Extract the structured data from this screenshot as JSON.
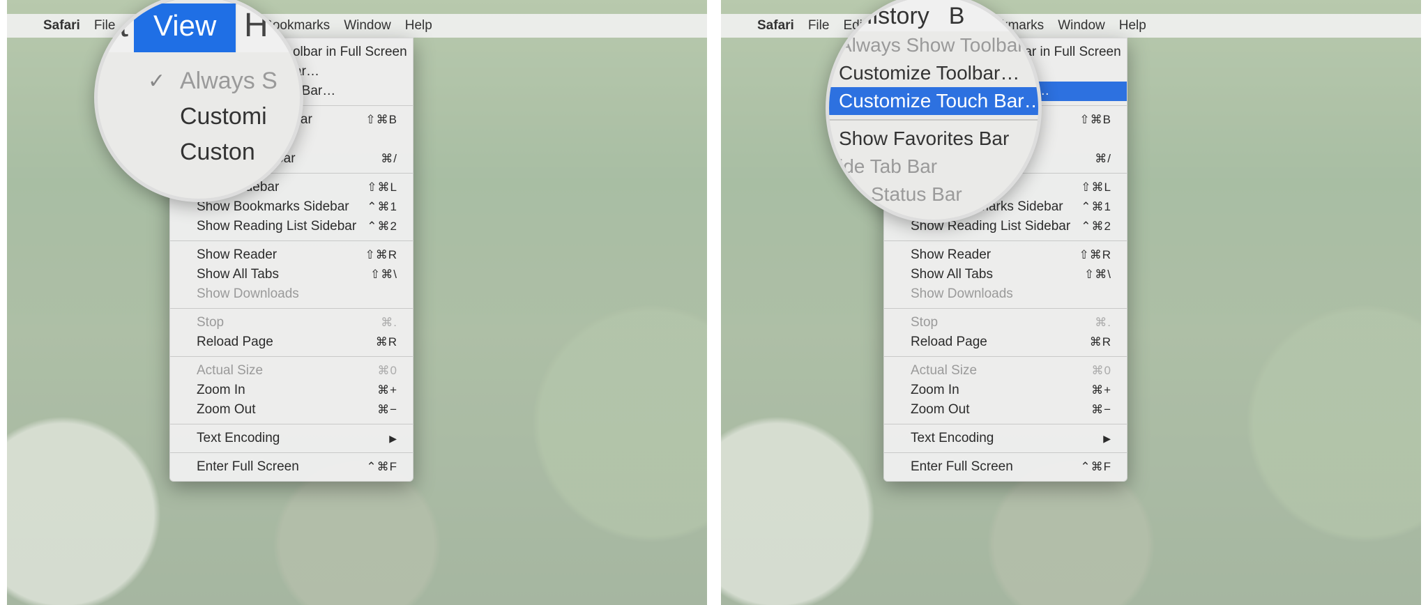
{
  "menubar": {
    "apple": "",
    "app": "Safari",
    "items": [
      "File",
      "Edit",
      "View",
      "History",
      "Bookmarks",
      "Window",
      "Help"
    ]
  },
  "dropdown_left": {
    "items": [
      {
        "label": "Always Show Toolbar in Full Screen",
        "shortcut": "",
        "checked": true
      },
      {
        "label": "Customize Toolbar…",
        "shortcut": ""
      },
      {
        "label": "Customize Touch Bar…",
        "shortcut": ""
      },
      {
        "sep": true
      },
      {
        "label": "Show Favorites Bar",
        "shortcut": "⇧⌘B"
      },
      {
        "label": "Hide Tab Bar",
        "shortcut": ""
      },
      {
        "label": "Show Status Bar",
        "shortcut": "⌘/"
      },
      {
        "sep": true
      },
      {
        "label": "Show Sidebar",
        "shortcut": "⇧⌘L"
      },
      {
        "label": "Show Bookmarks Sidebar",
        "shortcut": "⌃⌘1"
      },
      {
        "label": "Show Reading List Sidebar",
        "shortcut": "⌃⌘2"
      },
      {
        "sep": true
      },
      {
        "label": "Show Reader",
        "shortcut": "⇧⌘R"
      },
      {
        "label": "Show All Tabs",
        "shortcut": "⇧⌘\\"
      },
      {
        "label": "Show Downloads",
        "shortcut": "",
        "disabled": true
      },
      {
        "sep": true
      },
      {
        "label": "Stop",
        "shortcut": "⌘.",
        "disabled": true
      },
      {
        "label": "Reload Page",
        "shortcut": "⌘R"
      },
      {
        "sep": true
      },
      {
        "label": "Actual Size",
        "shortcut": "⌘0",
        "disabled": true
      },
      {
        "label": "Zoom In",
        "shortcut": "⌘+"
      },
      {
        "label": "Zoom Out",
        "shortcut": "⌘−"
      },
      {
        "sep": true
      },
      {
        "label": "Text Encoding",
        "shortcut": "",
        "submenu": true
      },
      {
        "sep": true
      },
      {
        "label": "Enter Full Screen",
        "shortcut": "⌃⌘F"
      }
    ]
  },
  "dropdown_right": {
    "items": [
      {
        "label": "Always Show Toolbar in Full Screen",
        "shortcut": "",
        "checked": true
      },
      {
        "label": "Customize Toolbar…",
        "shortcut": ""
      },
      {
        "label": "Customize Touch Bar…",
        "shortcut": "",
        "highlight": true
      },
      {
        "sep": true
      },
      {
        "label": "Show Favorites Bar",
        "shortcut": "⇧⌘B"
      },
      {
        "label": "Hide Tab Bar",
        "shortcut": ""
      },
      {
        "label": "Show Status Bar",
        "shortcut": "⌘/"
      },
      {
        "sep": true
      },
      {
        "label": "Show Sidebar",
        "shortcut": "⇧⌘L"
      },
      {
        "label": "Show Bookmarks Sidebar",
        "shortcut": "⌃⌘1"
      },
      {
        "label": "Show Reading List Sidebar",
        "shortcut": "⌃⌘2"
      },
      {
        "sep": true
      },
      {
        "label": "Show Reader",
        "shortcut": "⇧⌘R"
      },
      {
        "label": "Show All Tabs",
        "shortcut": "⇧⌘\\"
      },
      {
        "label": "Show Downloads",
        "shortcut": "",
        "disabled": true
      },
      {
        "sep": true
      },
      {
        "label": "Stop",
        "shortcut": "⌘.",
        "disabled": true
      },
      {
        "label": "Reload Page",
        "shortcut": "⌘R"
      },
      {
        "sep": true
      },
      {
        "label": "Actual Size",
        "shortcut": "⌘0",
        "disabled": true
      },
      {
        "label": "Zoom In",
        "shortcut": "⌘+"
      },
      {
        "label": "Zoom Out",
        "shortcut": "⌘−"
      },
      {
        "sep": true
      },
      {
        "label": "Text Encoding",
        "shortcut": "",
        "submenu": true
      },
      {
        "sep": true
      },
      {
        "label": "Enter Full Screen",
        "shortcut": "⌃⌘F"
      }
    ]
  },
  "mag_left": {
    "menubar_left_char": "t",
    "view": "View",
    "menubar_right_char": "H",
    "rows": [
      {
        "label": "Always S",
        "checked": true,
        "disabled": true
      },
      {
        "label": "Customi"
      },
      {
        "label": "Custon"
      }
    ]
  },
  "mag_right": {
    "top": [
      "History",
      "B"
    ],
    "rows": [
      {
        "label": "Always Show Toolbar",
        "disabled": true
      },
      {
        "label": "Customize Toolbar…"
      },
      {
        "label": "Customize Touch Bar…",
        "highlight": true
      },
      {
        "sep": true
      },
      {
        "label": "Show Favorites Bar"
      },
      {
        "label": "ide Tab Bar",
        "disabled": true
      },
      {
        "label": "Status Bar",
        "disabled": true,
        "pad": true
      }
    ]
  }
}
